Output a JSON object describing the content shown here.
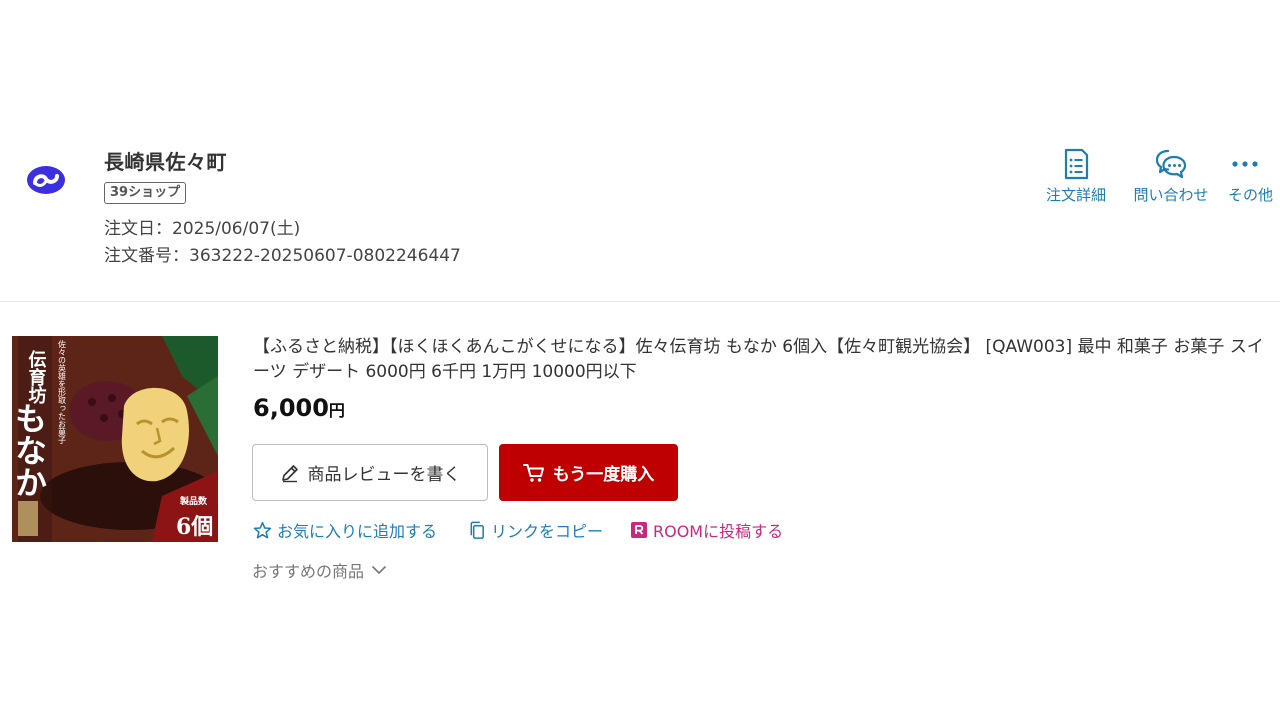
{
  "shop": {
    "name": "長崎県佐々町",
    "badge": "39ショップ",
    "order_date": "注文日：2025/06/07(土)",
    "order_number": "注文番号：363222-20250607-0802246447"
  },
  "actions": {
    "detail": "注文詳細",
    "contact": "問い合わせ",
    "other": "その他"
  },
  "item": {
    "title": "【ふるさと納税】【ほくほくあんこがくせになる】佐々伝育坊 もなか 6個入【佐々町観光協会】 [QAW003] 最中 和菓子 お菓子 スイーツ デザート 6000円 6千円 1万円 10000円以下",
    "price": "6,000",
    "currency": "円",
    "image_text": {
      "brand": "伝育坊",
      "name": "もなか",
      "tagline": "佐々の英雄を形取ったお菓子",
      "pack_label": "製品数",
      "count": "6個"
    }
  },
  "buttons": {
    "review": "商品レビューを書く",
    "rebuy": "もう一度購入"
  },
  "links": {
    "favorite": "お気に入りに追加する",
    "copy": "リンクをコピー",
    "room": "ROOMに投稿する"
  },
  "recommend": "おすすめの商品",
  "colors": {
    "accent_blue": "#1d7eb3",
    "rebuy_red": "#bf0000",
    "room_pink": "#c8297f",
    "logo_blue": "#3b2fe0"
  },
  "icons": {
    "logo": "rakuten-furusato-logo",
    "detail": "document-list-icon",
    "contact": "chat-bubbles-icon",
    "other": "more-dots-icon",
    "review": "pencil-icon",
    "rebuy": "cart-icon",
    "favorite": "star-outline-icon",
    "copy": "copy-icon",
    "room": "room-logo-icon",
    "recommend": "chevron-down-icon"
  }
}
